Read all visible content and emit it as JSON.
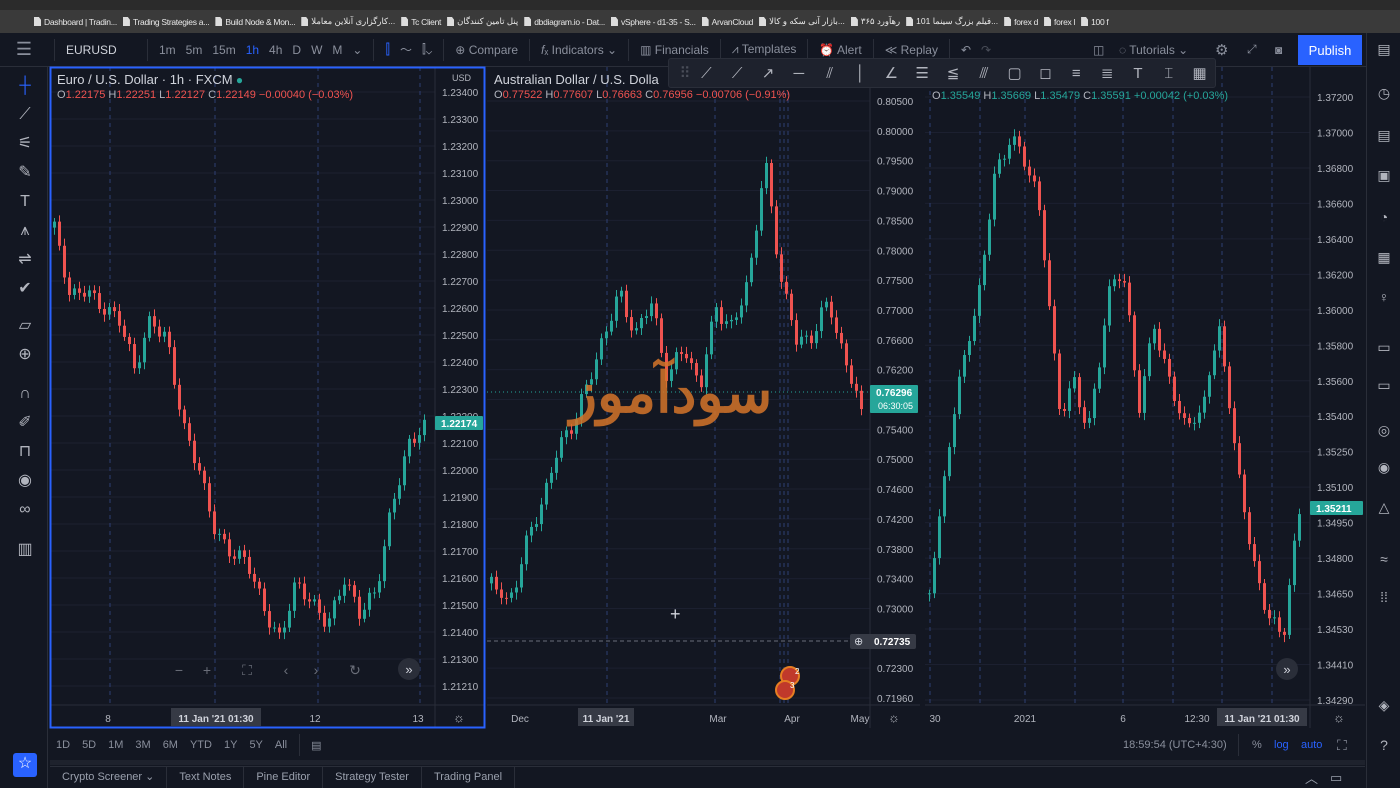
{
  "bookmarks": [
    "Dashboard | Tradin...",
    "Trading Strategies a...",
    "Build Node & Mon...",
    "کارگزاری آنلاین معاملا...",
    "Tc Client",
    "پنل تامین کنندگان",
    "dbdiagram.io - Dat...",
    "vSphere - d1-35 - S...",
    "ArvanCloud",
    "بازار آنی سکه و کالا...",
    "رهآورد ۳۶۵",
    "101 فیلم بزرگ سینما...",
    "forex d",
    "forex l",
    "100 f"
  ],
  "header": {
    "symbol": "EURUSD",
    "intervals": [
      "1m",
      "5m",
      "15m",
      "1h",
      "4h",
      "D",
      "W",
      "M"
    ],
    "active_interval": "1h",
    "compare": "Compare",
    "indicators": "Indicators",
    "financials": "Financials",
    "templates": "Templates",
    "alert": "Alert",
    "replay": "Replay",
    "tutorials": "Tutorials",
    "publish": "Publish"
  },
  "colors": {
    "up": "#26a69a",
    "down": "#ef5350",
    "accent": "#2962ff",
    "background": "#131722",
    "watermark": "#d4742a"
  },
  "watermark": "سودآموز",
  "panes": [
    {
      "title": "Euro / U.S. Dollar · 1h · FXCM",
      "currency": "USD",
      "ohlc": {
        "o": "1.22175",
        "h": "1.22251",
        "l": "1.22127",
        "c": "1.22149",
        "chg": "−0.00040 (−0.03%)"
      },
      "price_labels": [
        "1.23400",
        "1.23300",
        "1.23200",
        "1.23100",
        "1.23000",
        "1.22900",
        "1.22800",
        "1.22700",
        "1.22600",
        "1.22500",
        "1.22400",
        "1.22300",
        "1.22200",
        "1.22100",
        "1.22000",
        "1.21900",
        "1.21800",
        "1.21700",
        "1.21600",
        "1.21500",
        "1.21400",
        "1.21300",
        "1.21210"
      ],
      "last_price": "1.22174",
      "time_labels": [
        "8",
        "11 Jan '21  01:30",
        "12",
        "13"
      ],
      "price_path": [
        1.229,
        1.2262,
        1.2268,
        1.2262,
        1.2256,
        1.2236,
        1.2258,
        1.225,
        1.2215,
        1.22,
        1.218,
        1.217,
        1.2165,
        1.215,
        1.214,
        1.2158,
        1.215,
        1.2145,
        1.2162,
        1.2146,
        1.2155,
        1.219,
        1.221,
        1.2215
      ]
    },
    {
      "title": "Australian Dollar / U.S. Dolla",
      "ohlc": {
        "o": "0.77522",
        "h": "0.77607",
        "l": "0.76663",
        "c": "0.76956",
        "chg": "−0.00706 (−0.91%)"
      },
      "price_labels": [
        "0.80500",
        "0.80000",
        "0.79500",
        "0.79000",
        "0.78500",
        "0.78000",
        "0.77500",
        "0.77000",
        "0.76600",
        "0.76200",
        "0.75800",
        "0.75400",
        "0.75000",
        "0.74600",
        "0.74200",
        "0.73800",
        "0.73400",
        "0.73000",
        "0.72600",
        "0.72300",
        "0.71960"
      ],
      "last_price": "0.76296",
      "countdown": "06:30:05",
      "crosshair_price": "0.72735",
      "time_labels": [
        "Dec",
        "11 Jan '21",
        "Mar",
        "Apr",
        "May"
      ],
      "price_path": [
        0.736,
        0.733,
        0.74,
        0.747,
        0.754,
        0.759,
        0.764,
        0.772,
        0.777,
        0.772,
        0.776,
        0.765,
        0.77,
        0.764,
        0.776,
        0.772,
        0.78,
        0.796,
        0.78,
        0.77,
        0.772,
        0.776,
        0.768,
        0.76
      ]
    },
    {
      "ohlc": {
        "o": "1.35549",
        "h": "1.35669",
        "l": "1.35479",
        "c": "1.35591",
        "chg": "+0.00042 (+0.03%)"
      },
      "price_labels": [
        "1.37200",
        "1.37000",
        "1.36800",
        "1.36600",
        "1.36400",
        "1.36200",
        "1.36000",
        "1.35800",
        "1.35600",
        "1.35400",
        "1.35250",
        "1.35100",
        "1.34950",
        "1.34800",
        "1.34650",
        "1.34530",
        "1.34410",
        "1.34290"
      ],
      "last_price": "1.35211",
      "time_labels": [
        "30",
        "2021",
        "6",
        "12:30",
        "11 Jan '21  01:30"
      ],
      "price_path": [
        1.348,
        1.354,
        1.359,
        1.362,
        1.368,
        1.37,
        1.369,
        1.366,
        1.357,
        1.358,
        1.356,
        1.362,
        1.364,
        1.357,
        1.361,
        1.358,
        1.356,
        1.357,
        1.361,
        1.355,
        1.35,
        1.347,
        1.346,
        1.3521
      ]
    }
  ],
  "ranges": [
    "1D",
    "5D",
    "1M",
    "3M",
    "6M",
    "YTD",
    "1Y",
    "5Y",
    "All"
  ],
  "clock": "18:59:54 (UTC+4:30)",
  "scale_opts": {
    "percent": "%",
    "log": "log",
    "auto": "auto"
  },
  "bottom_tabs": [
    "Crypto Screener",
    "Text Notes",
    "Pine Editor",
    "Strategy Tester",
    "Trading Panel"
  ],
  "event_badges": [
    "2",
    "3"
  ]
}
